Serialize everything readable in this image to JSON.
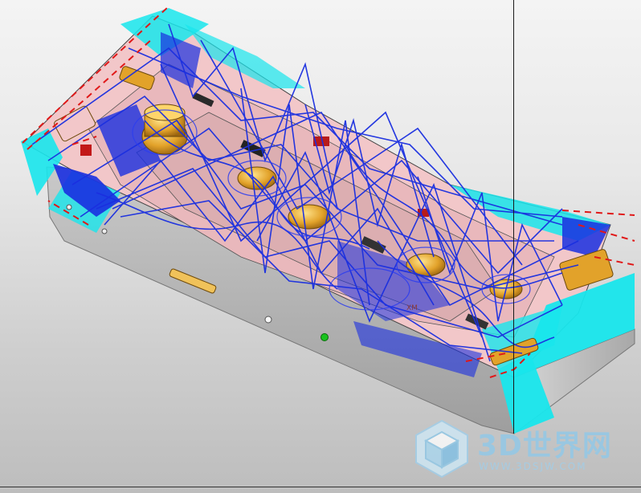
{
  "viewport": {
    "background": "gradient-gray"
  },
  "model": {
    "description_colors": {
      "body": "#b7b7b7",
      "tray_face": "#f2c7c9",
      "toolpath": "#1a2fe0",
      "cyan_region": "#18e6ec",
      "gold_part": "#e2a22a",
      "rapid_move": "#e01818",
      "green_marker": "#18c21e"
    },
    "label": "XM"
  },
  "watermark": {
    "title": "3D世界网",
    "url": "WWW.3DSJW.COM",
    "logo_icon": "cube-logo-icon",
    "color": "#8ec9ea"
  }
}
